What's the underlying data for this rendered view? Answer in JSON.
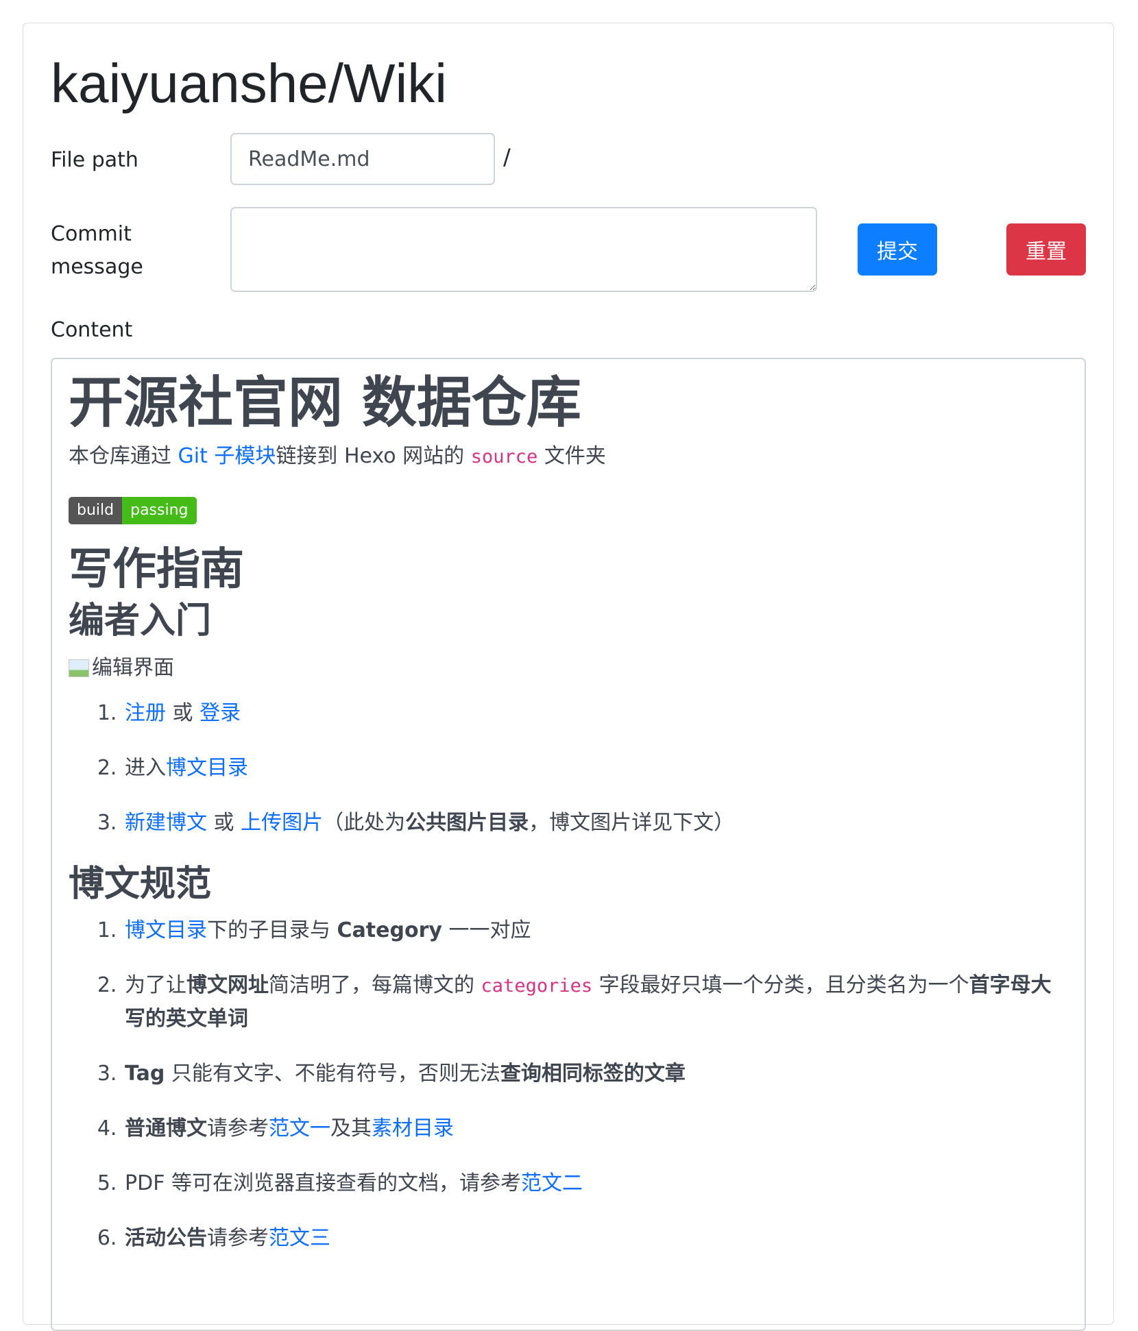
{
  "header": {
    "title": "kaiyuanshe/Wiki"
  },
  "form": {
    "file_path_label": "File path",
    "file_path_value": "ReadMe.md",
    "slash": "/",
    "commit_label_line1": "Commit",
    "commit_label_line2": "message",
    "commit_value": "",
    "submit_label": "提交",
    "reset_label": "重置",
    "content_label": "Content"
  },
  "colors": {
    "primary": "#0d7eff",
    "danger": "#dc3545",
    "link": "#0d6efd",
    "code": "#d63384",
    "badge_left": "#555555",
    "badge_right": "#44bb16"
  },
  "content": {
    "h1": "开源社官网 数据仓库",
    "intro": {
      "t1": "本仓库通过 ",
      "link1": "Git 子模块",
      "t2": "链接到 Hexo 网站的 ",
      "code1": "source",
      "t3": " 文件夹"
    },
    "badge": {
      "left": "build",
      "right": "passing"
    },
    "h2_guide": "写作指南",
    "h3_beginner": "编者入门",
    "image_alt": "编辑界面",
    "beginner_steps": {
      "s1_link1": "注册",
      "s1_t1": " 或 ",
      "s1_link2": "登录",
      "s2_t1": "进入",
      "s2_link1": "博文目录",
      "s3_link1": "新建博文",
      "s3_t1": " 或 ",
      "s3_link2": "上传图片",
      "s3_t2": "（此处为",
      "s3_bold": "公共图片目录",
      "s3_t3": "，博文图片详见下文）"
    },
    "h3_rules": "博文规范",
    "rules": {
      "r1_link": "博文目录",
      "r1_t1": "下的子目录与 ",
      "r1_bold": "Category",
      "r1_t2": " 一一对应",
      "r2_t1": "为了让",
      "r2_bold1": "博文网址",
      "r2_t2": "简洁明了，每篇博文的 ",
      "r2_code": "categories",
      "r2_t3": " 字段最好只填一个分类，且分类名为一个",
      "r2_bold2": "首字母大写的英文单词",
      "r3_bold1": "Tag",
      "r3_t1": " 只能有文字、不能有符号，否则无法",
      "r3_bold2": "查询相同标签的文章",
      "r4_bold": "普通博文",
      "r4_t1": "请参考",
      "r4_link1": "范文一",
      "r4_t2": "及其",
      "r4_link2": "素材目录",
      "r5_t1": "PDF 等可在浏览器直接查看的文档，请参考",
      "r5_link": "范文二",
      "r6_bold": "活动公告",
      "r6_t1": "请参考",
      "r6_link": "范文三"
    }
  }
}
